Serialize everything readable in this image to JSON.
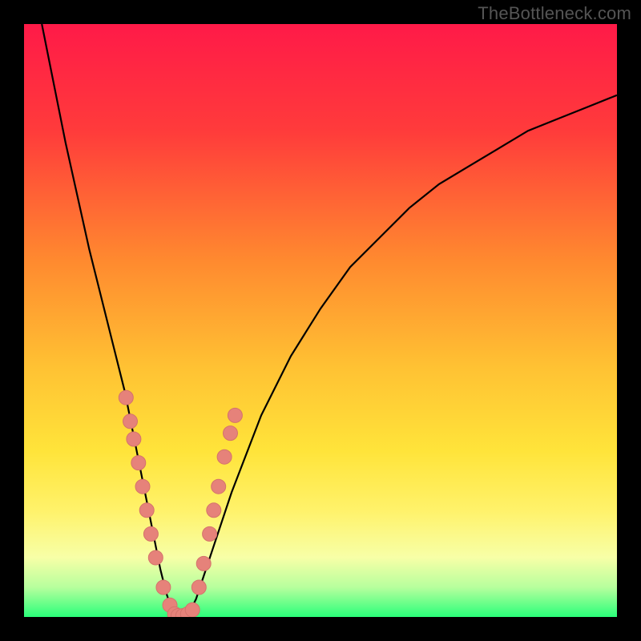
{
  "watermark": "TheBottleneck.com",
  "colors": {
    "frame": "#000000",
    "gradient_stops": [
      {
        "offset": 0.0,
        "color": "#ff1a48"
      },
      {
        "offset": 0.18,
        "color": "#ff3b3b"
      },
      {
        "offset": 0.4,
        "color": "#ff8a2f"
      },
      {
        "offset": 0.58,
        "color": "#ffc233"
      },
      {
        "offset": 0.72,
        "color": "#ffe43a"
      },
      {
        "offset": 0.82,
        "color": "#fff26a"
      },
      {
        "offset": 0.9,
        "color": "#f7ffa7"
      },
      {
        "offset": 0.95,
        "color": "#b7ff9d"
      },
      {
        "offset": 1.0,
        "color": "#2aff7a"
      }
    ],
    "curve_stroke": "#000000",
    "marker_fill": "#e6827a",
    "marker_stroke": "#d4736b"
  },
  "chart_data": {
    "type": "line",
    "title": "",
    "xlabel": "",
    "ylabel": "",
    "xlim": [
      0,
      100
    ],
    "ylim": [
      0,
      100
    ],
    "curve": {
      "comment": "V-shaped bottleneck curve; y is percent (0 at minimum). Values estimated from pixel positions.",
      "x": [
        3,
        5,
        7,
        9,
        11,
        13,
        15,
        17,
        18,
        19,
        20,
        21,
        22,
        23,
        24,
        25,
        26,
        27,
        28,
        29,
        30,
        32,
        35,
        40,
        45,
        50,
        55,
        60,
        65,
        70,
        75,
        80,
        85,
        90,
        95,
        100
      ],
      "y": [
        100,
        90,
        80,
        71,
        62,
        54,
        46,
        38,
        33,
        28,
        23,
        18,
        13,
        8,
        4,
        1,
        0,
        0,
        1,
        3,
        6,
        12,
        21,
        34,
        44,
        52,
        59,
        64,
        69,
        73,
        76,
        79,
        82,
        84,
        86,
        88
      ]
    },
    "series": [
      {
        "name": "left-branch-markers",
        "kind": "scatter",
        "points": [
          {
            "x": 17.2,
            "y": 37
          },
          {
            "x": 17.9,
            "y": 33
          },
          {
            "x": 18.5,
            "y": 30
          },
          {
            "x": 19.3,
            "y": 26
          },
          {
            "x": 20.0,
            "y": 22
          },
          {
            "x": 20.7,
            "y": 18
          },
          {
            "x": 21.4,
            "y": 14
          },
          {
            "x": 22.2,
            "y": 10
          },
          {
            "x": 23.5,
            "y": 5
          },
          {
            "x": 24.6,
            "y": 2
          }
        ]
      },
      {
        "name": "bottom-markers",
        "kind": "scatter",
        "points": [
          {
            "x": 25.4,
            "y": 0.5
          },
          {
            "x": 26.0,
            "y": 0.2
          },
          {
            "x": 26.8,
            "y": 0.2
          },
          {
            "x": 27.6,
            "y": 0.5
          },
          {
            "x": 28.4,
            "y": 1.2
          }
        ]
      },
      {
        "name": "right-branch-markers",
        "kind": "scatter",
        "points": [
          {
            "x": 29.5,
            "y": 5
          },
          {
            "x": 30.3,
            "y": 9
          },
          {
            "x": 31.3,
            "y": 14
          },
          {
            "x": 32.0,
            "y": 18
          },
          {
            "x": 32.8,
            "y": 22
          },
          {
            "x": 33.8,
            "y": 27
          },
          {
            "x": 34.8,
            "y": 31
          },
          {
            "x": 35.6,
            "y": 34
          }
        ]
      }
    ]
  }
}
